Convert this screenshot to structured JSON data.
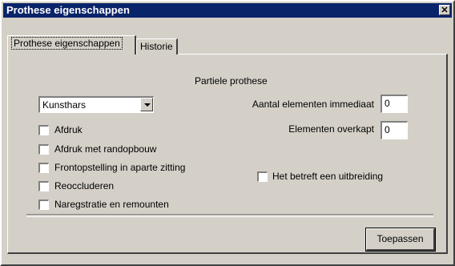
{
  "window": {
    "title": "Prothese eigenschappen",
    "close_glyph": "✕"
  },
  "tabs": [
    {
      "label": "Prothese eigenschappen",
      "active": true
    },
    {
      "label": "Historie",
      "active": false
    }
  ],
  "section_title": "Partiele prothese",
  "material_select": {
    "value": "Kunsthars"
  },
  "checkboxes": [
    {
      "label": "Afdruk",
      "checked": false
    },
    {
      "label": "Afdruk met randopbouw",
      "checked": false
    },
    {
      "label": "Frontopstelling in aparte zitting",
      "checked": false
    },
    {
      "label": "Reoccluderen",
      "checked": false
    },
    {
      "label": "Naregstratie en remounten",
      "checked": false
    }
  ],
  "fields": {
    "immediate_count": {
      "label": "Aantal elementen immediaat",
      "value": "0"
    },
    "covered_count": {
      "label": "Elementen overkapt",
      "value": "0"
    }
  },
  "extension_checkbox": {
    "label": "Het betreft een uitbreiding",
    "checked": false
  },
  "apply_button": {
    "label": "Toepassen"
  }
}
